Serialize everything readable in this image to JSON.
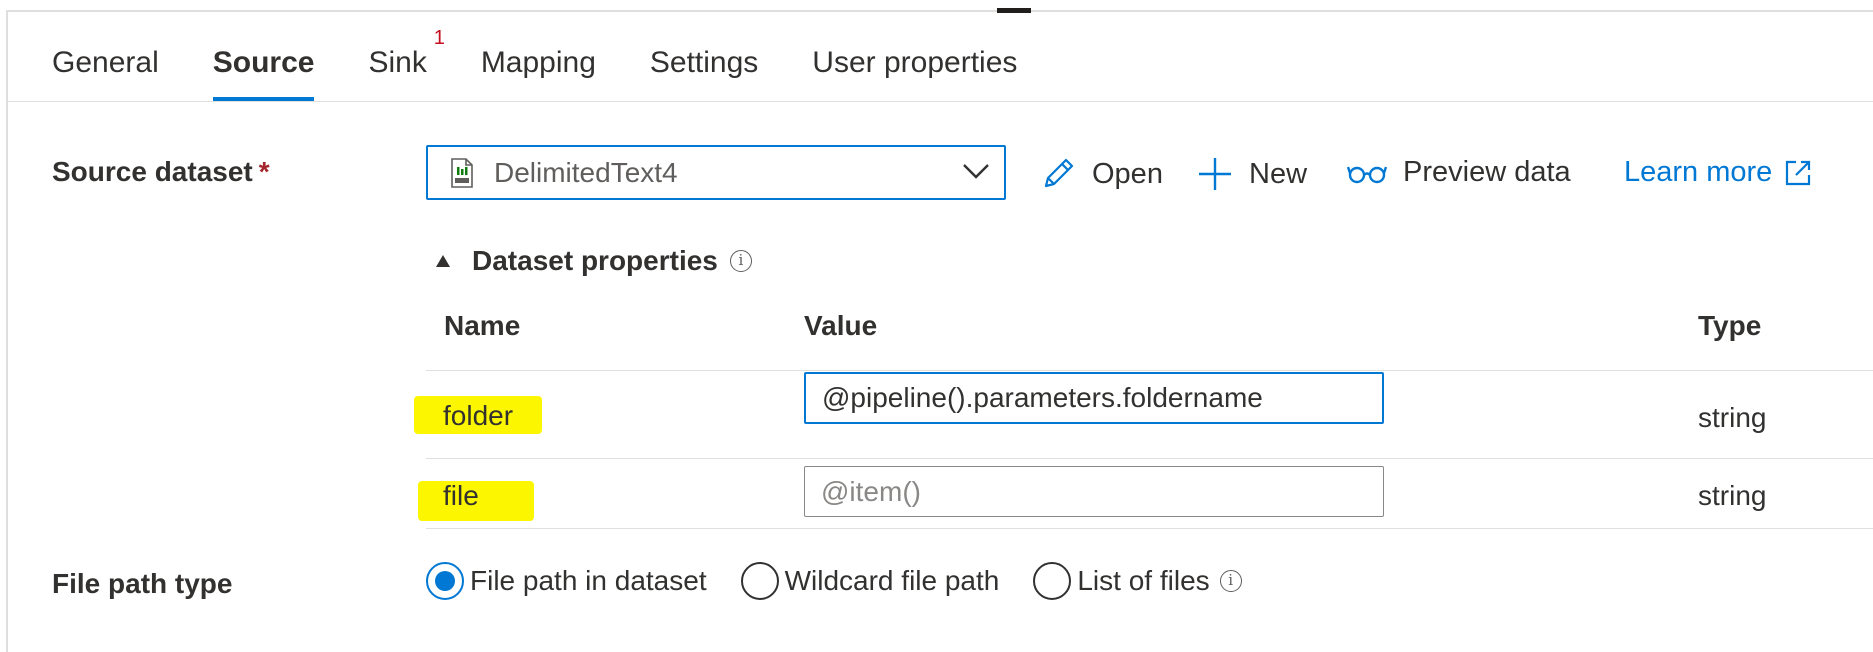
{
  "tabs": [
    {
      "label": "General"
    },
    {
      "label": "Source",
      "active": true
    },
    {
      "label": "Sink",
      "badge": "1"
    },
    {
      "label": "Mapping"
    },
    {
      "label": "Settings"
    },
    {
      "label": "User properties"
    }
  ],
  "source_dataset": {
    "label": "Source dataset",
    "required_mark": "*",
    "selected_value": "DelimitedText4",
    "icon": "csv-file-icon"
  },
  "toolbar": {
    "open_label": "Open",
    "new_label": "New",
    "preview_label": "Preview data",
    "learn_more_label": "Learn more"
  },
  "dataset_properties": {
    "title": "Dataset properties",
    "columns": {
      "name": "Name",
      "value": "Value",
      "type": "Type"
    },
    "rows": [
      {
        "name": "folder",
        "value": "@pipeline().parameters.foldername",
        "placeholder": "",
        "type": "string"
      },
      {
        "name": "file",
        "value": "",
        "placeholder": "@item()",
        "type": "string"
      }
    ]
  },
  "file_path_type": {
    "label": "File path type",
    "options": [
      {
        "label": "File path in dataset",
        "checked": true
      },
      {
        "label": "Wildcard file path",
        "checked": false
      },
      {
        "label": "List of files",
        "checked": false
      }
    ]
  },
  "colors": {
    "accent": "#0078d4",
    "highlight": "#fcf700",
    "badge": "#c50f1f",
    "required": "#a4262c"
  }
}
